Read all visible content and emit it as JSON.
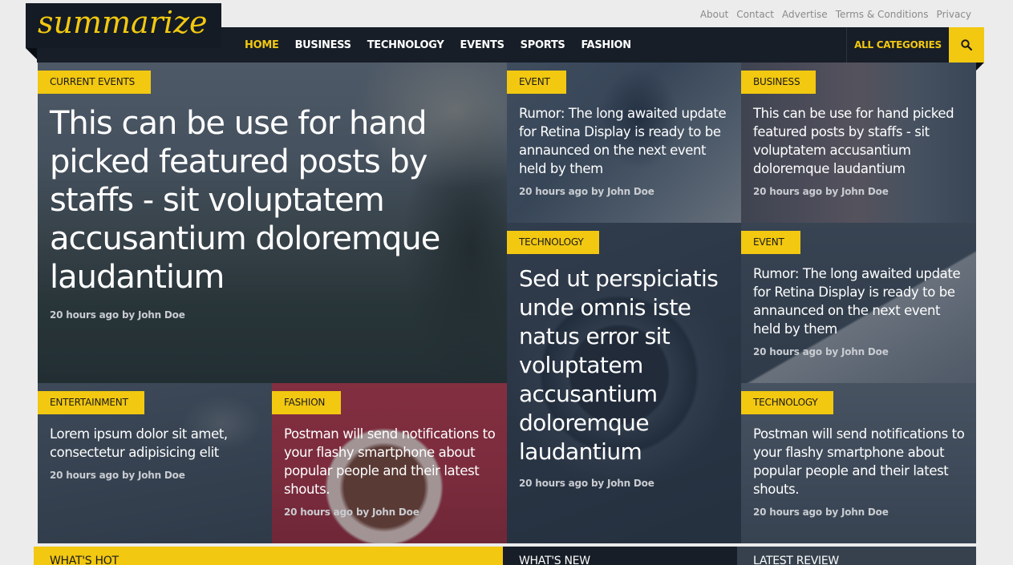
{
  "top_links": [
    "About",
    "Contact",
    "Advertise",
    "Terms & Conditions",
    "Privacy"
  ],
  "logo": "summarize",
  "nav": {
    "items": [
      "HOME",
      "BUSINESS",
      "TECHNOLOGY",
      "EVENTS",
      "SPORTS",
      "FASHION"
    ],
    "all_categories": "ALL CATEGORIES"
  },
  "colors": {
    "accent": "#f2c811",
    "dark": "#171e27"
  },
  "icons": {
    "search": "search-icon"
  },
  "tiles": [
    {
      "category": "CURRENT EVENTS",
      "title": "This can be use for hand picked featured posts by staffs - sit voluptatem accusantium doloremque laudantium",
      "meta": "20 hours ago by John Doe"
    },
    {
      "category": "EVENT",
      "title": "Rumor: The long awaited update for Retina Display is ready to be annaunced on the next event held by them",
      "meta": "20 hours ago by John Doe"
    },
    {
      "category": "BUSINESS",
      "title": "This can be use for hand picked featured posts by staffs - sit voluptatem accusantium doloremque laudantium",
      "meta": "20 hours ago by John Doe"
    },
    {
      "category": "TECHNOLOGY",
      "title": "Sed ut perspiciatis unde omnis iste natus error sit voluptatem accusantium doloremque laudantium",
      "meta": "20 hours ago by John Doe"
    },
    {
      "category": "EVENT",
      "title": "Rumor: The long awaited update for Retina Display is ready to be annaunced on the next event held by them",
      "meta": "20 hours ago by John Doe"
    },
    {
      "category": "ENTERTAINMENT",
      "title": "Lorem ipsum dolor sit amet, consectetur adipisicing elit",
      "meta": "20 hours ago by John Doe"
    },
    {
      "category": "FASHION",
      "title": "Postman will send notifications to your flashy smartphone about popular people and their latest shouts.",
      "meta": "20 hours ago by John Doe"
    },
    {
      "category": "TECHNOLOGY",
      "title": "Postman will send notifications to your flashy smartphone about popular people and their latest shouts.",
      "meta": "20 hours ago by John Doe"
    }
  ],
  "sections": [
    "WHAT'S HOT",
    "WHAT'S NEW",
    "LATEST REVIEW"
  ]
}
